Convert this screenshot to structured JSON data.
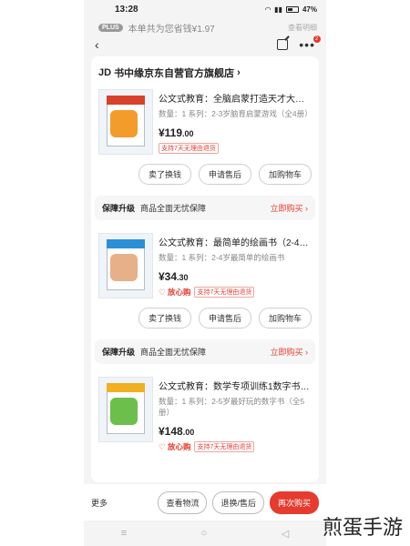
{
  "status": {
    "time": "13:28",
    "battery": "47%"
  },
  "plus_bar": {
    "tag": "PLUS",
    "text": "本单共为您省钱¥1.97",
    "right": "查看明细"
  },
  "nav": {
    "back": "‹",
    "more": "•••",
    "badge": "2"
  },
  "store": {
    "name": "书中缘京东自营官方旗舰店",
    "chevron": "›"
  },
  "items": [
    {
      "title": "公文式教育：全脑启蒙打造天才大脑…",
      "meta": "数量：1  系列：2-3岁脑育启蒙游戏（全4册）",
      "price_int": "¥119",
      "price_dec": ".00",
      "heart": "",
      "tag": "支持7天无理由退货",
      "actions": [
        "卖了换钱",
        "申请售后",
        "加购物车"
      ],
      "cover": "#d8412b"
    },
    {
      "title": "公文式教育：最简单的绘画书（2-4…",
      "meta": "数量：1  系列：2-4岁最简单的绘画书",
      "price_int": "¥34",
      "price_dec": ".30",
      "heart": "♡ 放心购",
      "tag": "支持7天无理由退货",
      "actions": [
        "卖了换钱",
        "申请售后",
        "加购物车"
      ],
      "cover": "#2b8fd8"
    },
    {
      "title": "公文式教育：数学专项训练1数字书 2…",
      "meta": "数量：1  系列：2-5岁最好玩的数字书（全5册）",
      "price_int": "¥148",
      "price_dec": ".00",
      "heart": "♡ 放心购",
      "tag": "支持7天无理由退货",
      "actions": [],
      "cover": "#f0b020"
    }
  ],
  "guarantee": {
    "title": "保障升级",
    "sub": "商品全面无忧保障",
    "buy": "立即购买 ›"
  },
  "bottom": {
    "more": "更多",
    "logistics": "查看物流",
    "after_sale": "退换/售后",
    "rebuy": "再次购买"
  },
  "sysnav": [
    "≡",
    "○",
    "◁"
  ],
  "watermark": "煎蛋手游",
  "colors": {
    "accent": "#e63b2e"
  }
}
